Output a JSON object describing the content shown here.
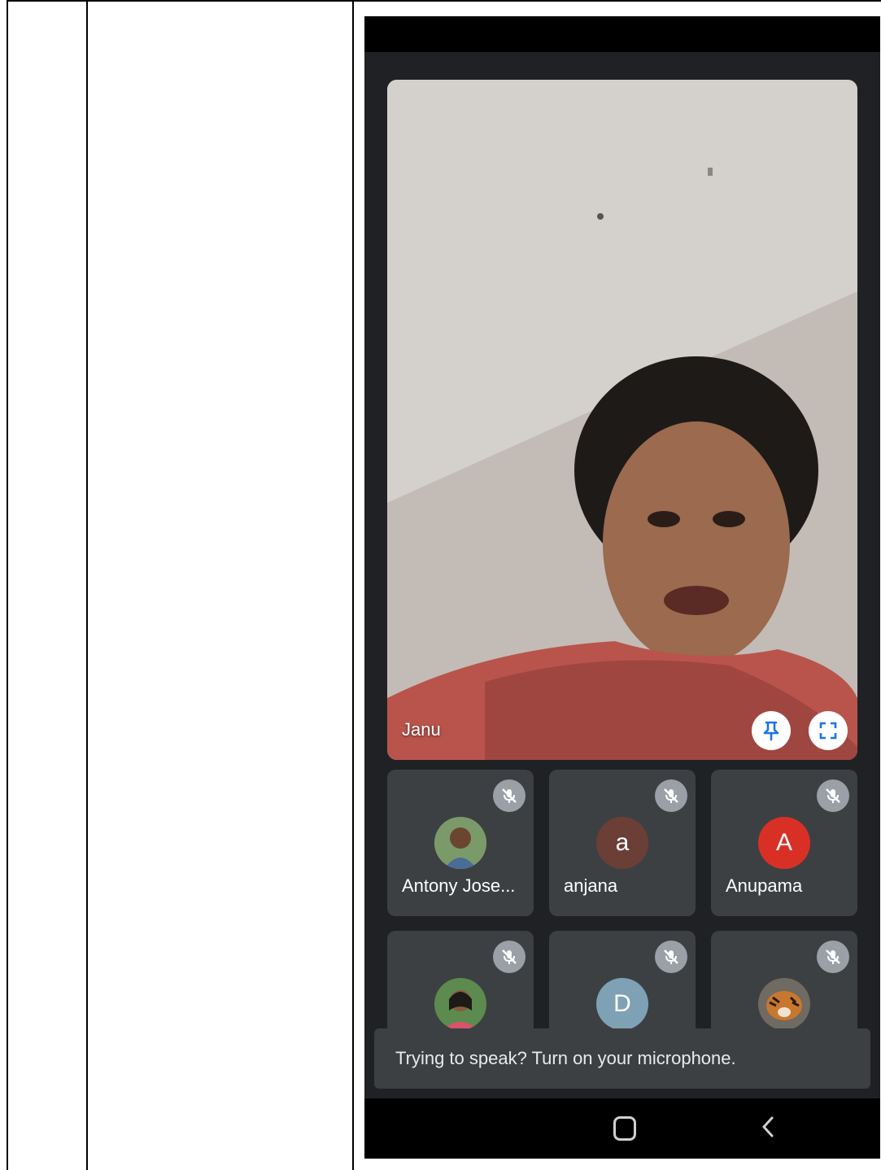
{
  "main_participant": {
    "name": "Janu"
  },
  "participants": [
    {
      "name": "Antony Jose...",
      "avatar_type": "photo",
      "initial": ""
    },
    {
      "name": "anjana",
      "avatar_type": "letter",
      "initial": "a",
      "color": "#6b3f36"
    },
    {
      "name": "Anupama",
      "avatar_type": "letter",
      "initial": "A",
      "color": "#d93025"
    },
    {
      "name": "",
      "avatar_type": "photo",
      "initial": ""
    },
    {
      "name": "",
      "avatar_type": "letter",
      "initial": "D",
      "color": "#7fa1b6"
    },
    {
      "name": "",
      "avatar_type": "photo",
      "initial": ""
    }
  ],
  "toast": {
    "message": "Trying to speak? Turn on your microphone."
  },
  "icons": {
    "pin": "pin-icon",
    "fullscreen": "fullscreen-icon",
    "muted": "mic-off-icon",
    "home": "home-icon",
    "back": "back-icon"
  }
}
